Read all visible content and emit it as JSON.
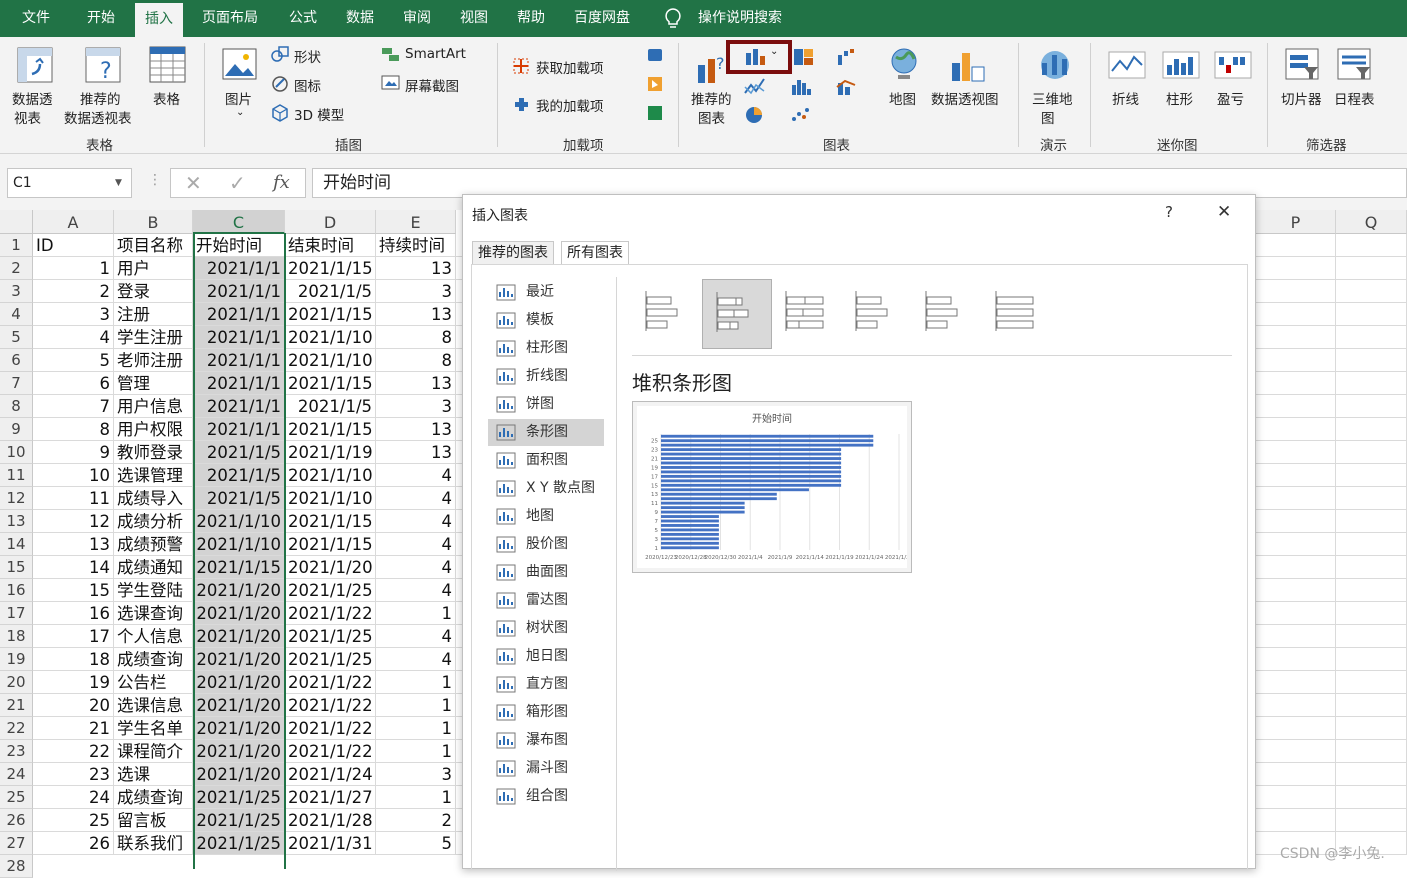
{
  "tabs": [
    "文件",
    "开始",
    "插入",
    "页面布局",
    "公式",
    "数据",
    "审阅",
    "视图",
    "帮助",
    "百度网盘"
  ],
  "tell_me": "操作说明搜索",
  "ribbon": {
    "pivot": "数据透",
    "pivot2": "视表",
    "rec_pivot": "推荐的",
    "rec_pivot2": "数据透视表",
    "table": "表格",
    "picture": "图片",
    "shapes": "形状",
    "icons": "图标",
    "model3d": "3D 模型",
    "smartart": "SmartArt",
    "screenshot": "屏幕截图",
    "get_addins": "获取加载项",
    "my_addins": "我的加载项",
    "rec_chart": "推荐的",
    "rec_chart2": "图表",
    "map": "地图",
    "pivot_chart": "数据透视图",
    "map3d": "三维地",
    "map3d2": "图",
    "line": "折线",
    "column": "柱形",
    "winloss": "盈亏",
    "slicer": "切片器",
    "timeline": "日程表",
    "groups": [
      "表格",
      "插图",
      "加载项",
      "图表",
      "演示",
      "迷你图",
      "筛选器"
    ]
  },
  "formula_bar": {
    "name_box": "C1",
    "content": "开始时间"
  },
  "columns": [
    "A",
    "B",
    "C",
    "D",
    "E",
    "P",
    "Q"
  ],
  "headers": [
    "ID",
    "项目名称",
    "开始时间",
    "结束时间",
    "持续时间"
  ],
  "rows": [
    [
      "1",
      "用户",
      "2021/1/1",
      "2021/1/15",
      "13"
    ],
    [
      "2",
      "登录",
      "2021/1/1",
      "2021/1/5",
      "3"
    ],
    [
      "3",
      "注册",
      "2021/1/1",
      "2021/1/15",
      "13"
    ],
    [
      "4",
      "学生注册",
      "2021/1/1",
      "2021/1/10",
      "8"
    ],
    [
      "5",
      "老师注册",
      "2021/1/1",
      "2021/1/10",
      "8"
    ],
    [
      "6",
      "管理",
      "2021/1/1",
      "2021/1/15",
      "13"
    ],
    [
      "7",
      "用户信息",
      "2021/1/1",
      "2021/1/5",
      "3"
    ],
    [
      "8",
      "用户权限",
      "2021/1/1",
      "2021/1/15",
      "13"
    ],
    [
      "9",
      "教师登录",
      "2021/1/5",
      "2021/1/19",
      "13"
    ],
    [
      "10",
      "选课管理",
      "2021/1/5",
      "2021/1/10",
      "4"
    ],
    [
      "11",
      "成绩导入",
      "2021/1/5",
      "2021/1/10",
      "4"
    ],
    [
      "12",
      "成绩分析",
      "2021/1/10",
      "2021/1/15",
      "4"
    ],
    [
      "13",
      "成绩预警",
      "2021/1/10",
      "2021/1/15",
      "4"
    ],
    [
      "14",
      "成绩通知",
      "2021/1/15",
      "2021/1/20",
      "4"
    ],
    [
      "15",
      "学生登陆",
      "2021/1/20",
      "2021/1/25",
      "4"
    ],
    [
      "16",
      "选课查询",
      "2021/1/20",
      "2021/1/22",
      "1"
    ],
    [
      "17",
      "个人信息",
      "2021/1/20",
      "2021/1/25",
      "4"
    ],
    [
      "18",
      "成绩查询",
      "2021/1/20",
      "2021/1/25",
      "4"
    ],
    [
      "19",
      "公告栏",
      "2021/1/20",
      "2021/1/22",
      "1"
    ],
    [
      "20",
      "选课信息",
      "2021/1/20",
      "2021/1/22",
      "1"
    ],
    [
      "21",
      "学生名单",
      "2021/1/20",
      "2021/1/22",
      "1"
    ],
    [
      "22",
      "课程简介",
      "2021/1/20",
      "2021/1/22",
      "1"
    ],
    [
      "23",
      "选课",
      "2021/1/20",
      "2021/1/24",
      "3"
    ],
    [
      "24",
      "成绩查询",
      "2021/1/25",
      "2021/1/27",
      "1"
    ],
    [
      "25",
      "留言板",
      "2021/1/25",
      "2021/1/28",
      "2"
    ],
    [
      "26",
      "联系我们",
      "2021/1/25",
      "2021/1/31",
      "5"
    ]
  ],
  "dialog": {
    "title": "插入图表",
    "help": "?",
    "close": "✕",
    "tab_recommended": "推荐的图表",
    "tab_all": "所有图表",
    "chart_types": [
      "最近",
      "模板",
      "柱形图",
      "折线图",
      "饼图",
      "条形图",
      "面积图",
      "X Y 散点图",
      "地图",
      "股价图",
      "曲面图",
      "雷达图",
      "树状图",
      "旭日图",
      "直方图",
      "箱形图",
      "瀑布图",
      "漏斗图",
      "组合图"
    ],
    "selected_type": "堆积条形图",
    "preview_title": "开始时间",
    "preview_y_ticks": [
      "25",
      "23",
      "21",
      "19",
      "17",
      "15",
      "13",
      "11",
      "9",
      "7",
      "5",
      "3",
      "1"
    ],
    "preview_x_ticks": [
      "2020/12/23",
      "2020/12/28",
      "2020/12/30",
      "2021/1/4",
      "2021/1/9",
      "2021/1/14",
      "2021/1/19",
      "2021/1/24",
      "2021/1/29"
    ]
  },
  "chart_data": {
    "type": "bar",
    "title": "开始时间",
    "categories": [
      "1",
      "2",
      "3",
      "4",
      "5",
      "6",
      "7",
      "8",
      "9",
      "10",
      "11",
      "12",
      "13",
      "14",
      "15",
      "16",
      "17",
      "18",
      "19",
      "20",
      "21",
      "22",
      "23",
      "24",
      "25",
      "26"
    ],
    "values": [
      "2021/1/1",
      "2021/1/1",
      "2021/1/1",
      "2021/1/1",
      "2021/1/1",
      "2021/1/1",
      "2021/1/1",
      "2021/1/1",
      "2021/1/5",
      "2021/1/5",
      "2021/1/5",
      "2021/1/10",
      "2021/1/10",
      "2021/1/15",
      "2021/1/20",
      "2021/1/20",
      "2021/1/20",
      "2021/1/20",
      "2021/1/20",
      "2021/1/20",
      "2021/1/20",
      "2021/1/20",
      "2021/1/20",
      "2021/1/25",
      "2021/1/25",
      "2021/1/25"
    ],
    "xlim": [
      "2020/12/23",
      "2021/1/29"
    ]
  },
  "watermark": "CSDN @李小兔.",
  "colors": {
    "excel_green": "#217346",
    "highlight_box": "#7b0d0d",
    "bar_blue": "#4472c4"
  }
}
